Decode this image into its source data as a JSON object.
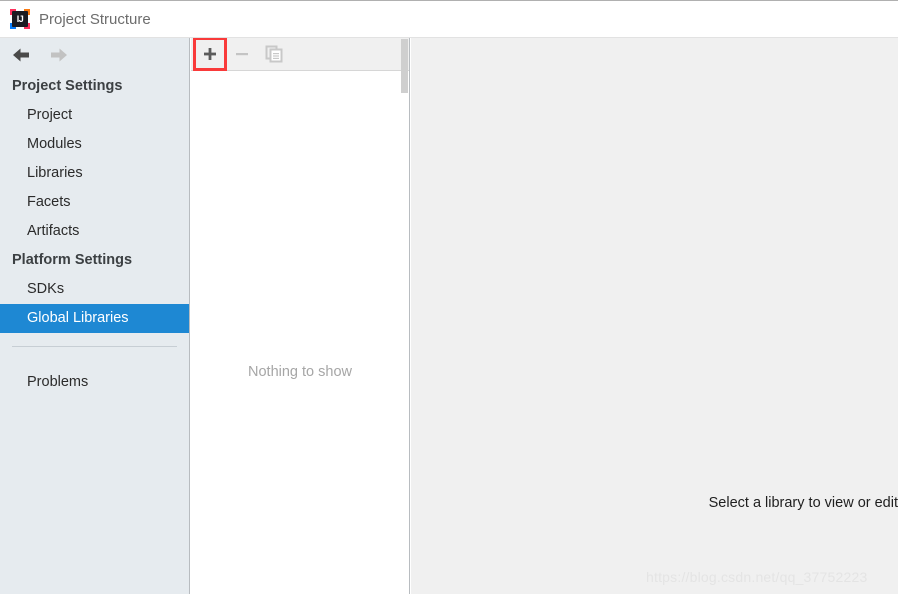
{
  "window": {
    "title": "Project Structure",
    "app_icon": "intellij-idea-icon",
    "letters": "IJ"
  },
  "navigation": {
    "back_icon": "arrow-left-icon",
    "forward_icon": "arrow-right-icon",
    "back_enabled": "true",
    "forward_enabled": "false"
  },
  "sidebar": {
    "groups": [
      {
        "header": "Project Settings",
        "items": [
          {
            "label": "Project",
            "selected": false
          },
          {
            "label": "Modules",
            "selected": false
          },
          {
            "label": "Libraries",
            "selected": false
          },
          {
            "label": "Facets",
            "selected": false
          },
          {
            "label": "Artifacts",
            "selected": false
          }
        ]
      },
      {
        "header": "Platform Settings",
        "items": [
          {
            "label": "SDKs",
            "selected": false
          },
          {
            "label": "Global Libraries",
            "selected": true
          }
        ]
      }
    ],
    "footer_item": {
      "label": "Problems"
    }
  },
  "list_panel": {
    "toolbar": {
      "add": {
        "label": "+",
        "icon": "plus-icon",
        "enabled": true,
        "highlighted": true
      },
      "remove": {
        "label": "−",
        "icon": "minus-icon",
        "enabled": false,
        "highlighted": false
      },
      "copy": {
        "label": "",
        "icon": "copy-icon",
        "enabled": false,
        "highlighted": false
      }
    },
    "empty_text": "Nothing to show",
    "scrollbar": "vertical-scrollbar"
  },
  "detail_panel": {
    "hint_text": "Select a library to view or edit"
  },
  "watermark": {
    "text": "https://blog.csdn.net/qq_37752223"
  },
  "colors": {
    "selection_blue": "#1e88d3",
    "highlight_red": "#f93a3a",
    "sidebar_bg": "#e6ebef",
    "panel_bg": "#f0f0f0",
    "list_bg": "#ffffff"
  }
}
